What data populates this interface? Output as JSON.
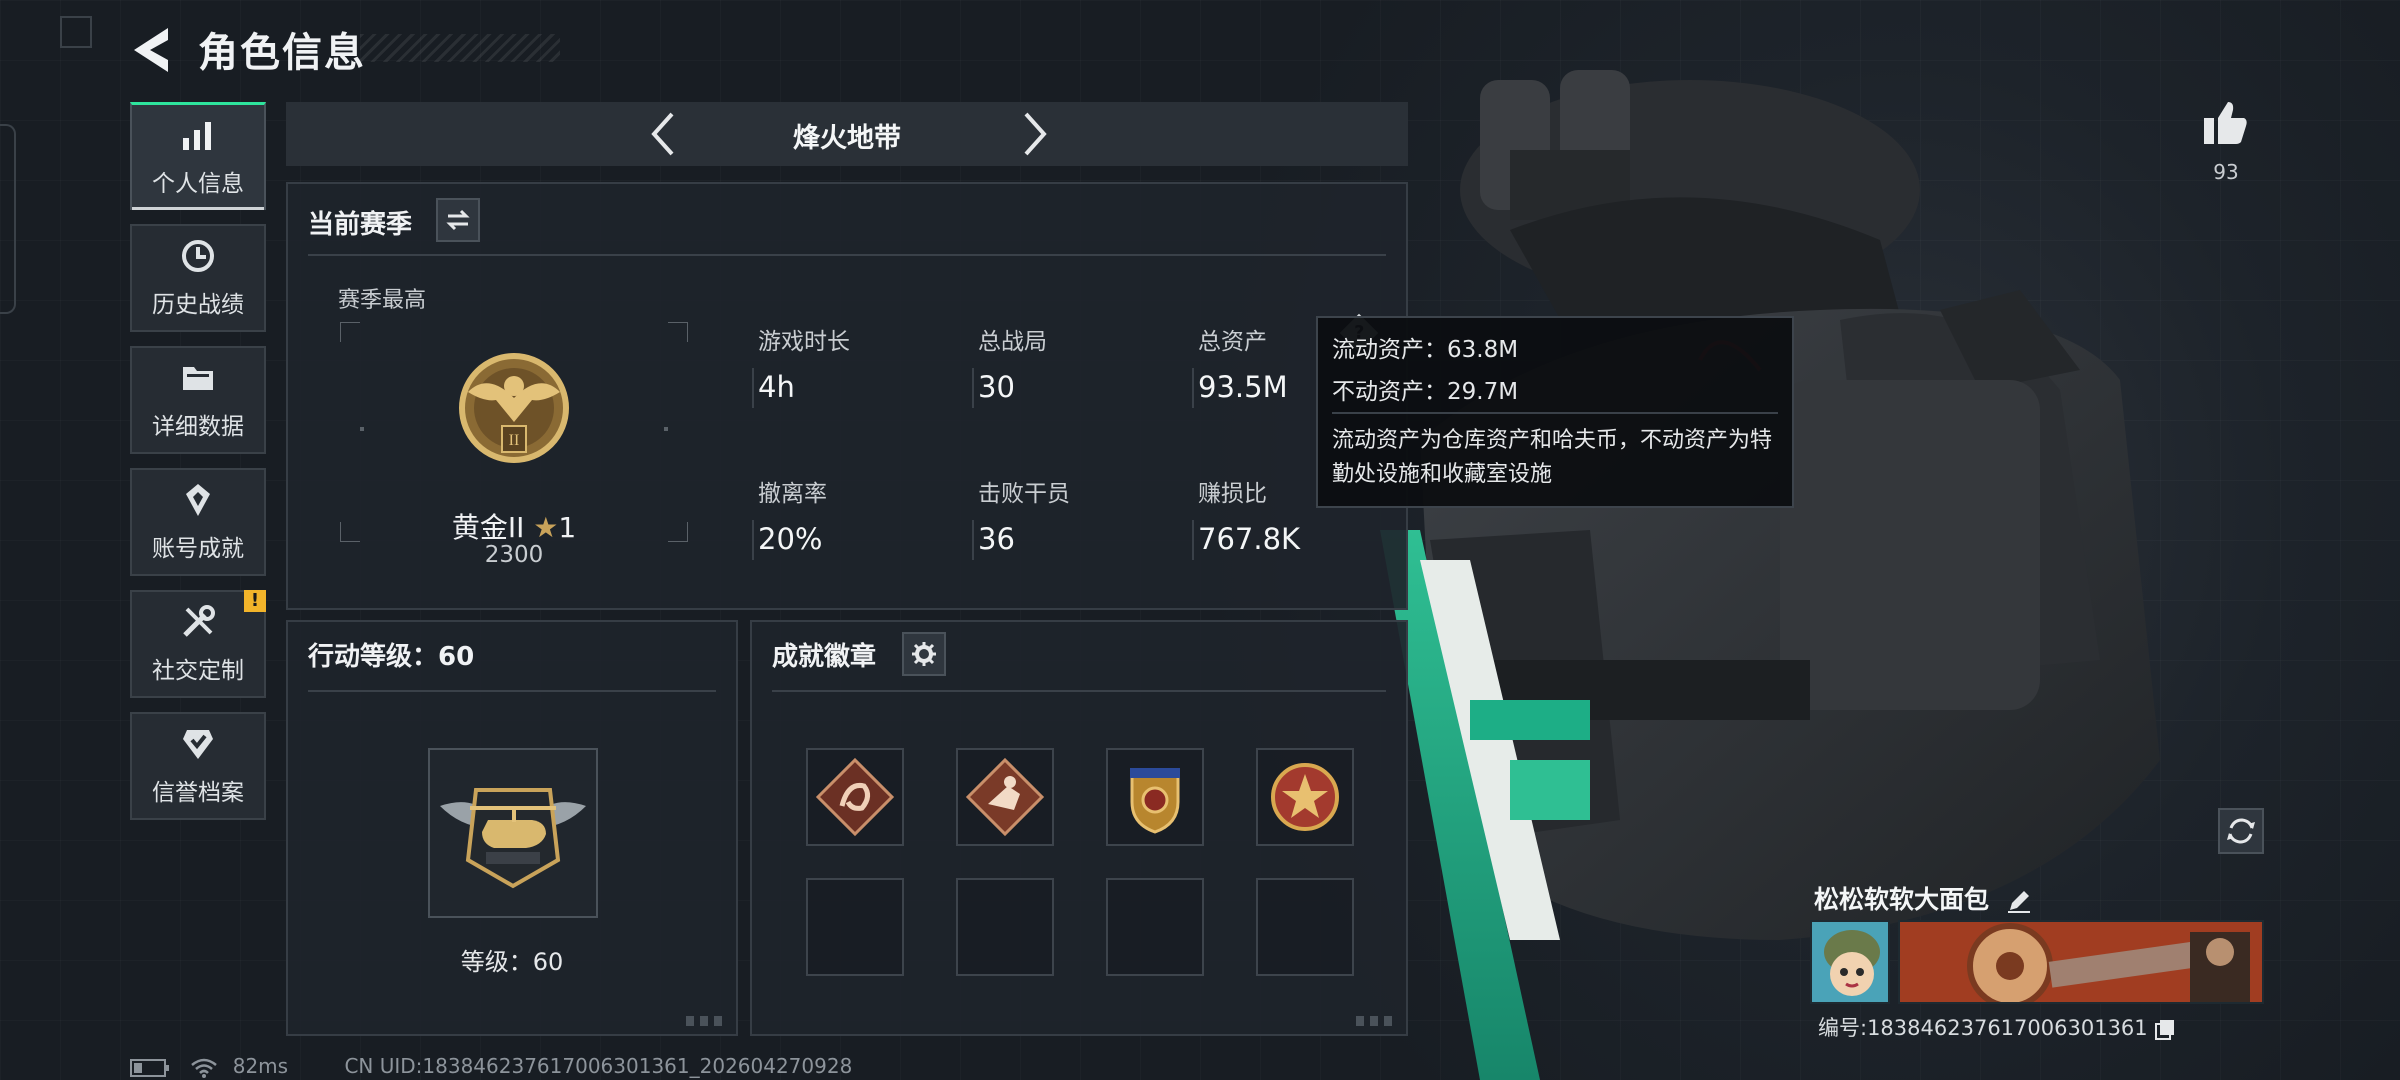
{
  "header": {
    "title": "角色信息"
  },
  "nav": {
    "items": [
      {
        "label": "个人信息",
        "icon": "bar-chart-icon",
        "active": true
      },
      {
        "label": "历史战绩",
        "icon": "history-clock-icon"
      },
      {
        "label": "详细数据",
        "icon": "folder-icon"
      },
      {
        "label": "账号成就",
        "icon": "achievement-icon"
      },
      {
        "label": "社交定制",
        "icon": "tools-icon",
        "badge": "!"
      },
      {
        "label": "信誉档案",
        "icon": "shield-check-icon"
      }
    ]
  },
  "mode": {
    "title": "烽火地带"
  },
  "season": {
    "heading": "当前赛季",
    "best_label": "赛季最高",
    "rank_name": "黄金II",
    "rank_stars": "1",
    "rank_score": "2300",
    "rank_emblem_numeral": "II",
    "stats": [
      {
        "label": "游戏时长",
        "value": "4h"
      },
      {
        "label": "总战局",
        "value": "30"
      },
      {
        "label": "总资产",
        "value": "93.5M",
        "help": "?"
      },
      {
        "label": "撤离率",
        "value": "20%"
      },
      {
        "label": "击败干员",
        "value": "36"
      },
      {
        "label": "赚损比",
        "value": "767.8K"
      }
    ]
  },
  "tooltip": {
    "liquid": "流动资产：63.8M",
    "fixed": "不动资产：29.7M",
    "desc": "流动资产为仓库资产和哈夫币，不动资产为特勤处设施和收藏室设施"
  },
  "action_level": {
    "heading": "行动等级：60",
    "level_text": "等级：60"
  },
  "badges": {
    "heading": "成就徽章",
    "slots_filled": 4,
    "slots_total": 8
  },
  "likes": {
    "count": "93"
  },
  "profile": {
    "username": "松松软软大面包",
    "id_text": "编号:18384623761700630136​1"
  },
  "status": {
    "ping": "82ms",
    "uid": "CN UID:18384623761700630136​1_202604270928"
  },
  "colors": {
    "accent_green": "#2ee59d",
    "gold": "#c9a35a",
    "warn": "#f2b42a"
  }
}
